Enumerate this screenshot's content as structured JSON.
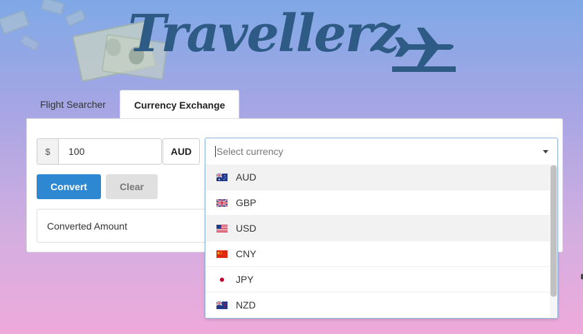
{
  "brand": {
    "logo_text": "Travellerz",
    "logo_color": "#2e5b86"
  },
  "tabs": [
    {
      "label": "Flight Searcher",
      "active": false
    },
    {
      "label": "Currency Exchange",
      "active": true
    }
  ],
  "converter": {
    "currency_symbol": "$",
    "amount_value": "100",
    "from_currency": "AUD",
    "convert_label": "Convert",
    "clear_label": "Clear",
    "result_label": "Converted Amount"
  },
  "currency_select": {
    "placeholder": "Select currency",
    "options": [
      {
        "code": "AUD",
        "flag": "au-flag-icon"
      },
      {
        "code": "GBP",
        "flag": "gb-flag-icon"
      },
      {
        "code": "USD",
        "flag": "us-flag-icon"
      },
      {
        "code": "CNY",
        "flag": "cn-flag-icon"
      },
      {
        "code": "JPY",
        "flag": "jp-flag-icon"
      },
      {
        "code": "NZD",
        "flag": "nz-flag-icon"
      }
    ]
  },
  "colors": {
    "accent": "#2d87d1",
    "clear_button": "#e0e0e0",
    "select_border": "#8ab0d9"
  }
}
